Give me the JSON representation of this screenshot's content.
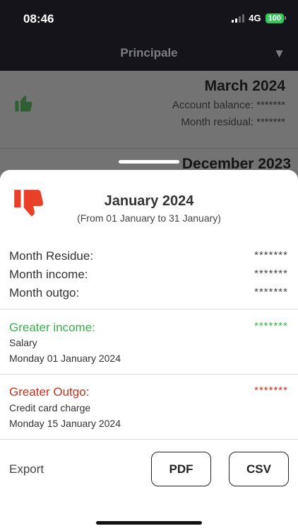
{
  "status": {
    "time": "08:46",
    "network": "4G",
    "battery": "100"
  },
  "nav": {
    "title": "Principale",
    "menu_arrow": "▼"
  },
  "background_list": [
    {
      "month": "March 2024",
      "balance": "Account balance: *******",
      "residual": "Month residual: *******",
      "icon": "thumbs-up-icon"
    },
    {
      "month": "December 2023"
    }
  ],
  "sheet": {
    "icon": "thumbs-down-icon",
    "title": "January 2024",
    "subtitle": "(From 01 January to 31 January)",
    "summary": [
      {
        "label": "Month Residue:",
        "value": "*******"
      },
      {
        "label": "Month income:",
        "value": "*******"
      },
      {
        "label": "Month outgo:",
        "value": "*******"
      }
    ],
    "greater_income": {
      "label": "Greater income:",
      "value": "*******",
      "description": "Salary",
      "date": "Monday 01 January 2024"
    },
    "greater_outgo": {
      "label": "Greater Outgo:",
      "value": "*******",
      "description": "Credit card charge",
      "date": "Monday 15 January 2024"
    },
    "export": {
      "label": "Export",
      "pdf": "PDF",
      "csv": "CSV"
    }
  },
  "colors": {
    "income": "#35b34a",
    "outgo": "#c8321e",
    "thumb_up": "#2e7d32",
    "thumb_down": "#e8402a"
  }
}
